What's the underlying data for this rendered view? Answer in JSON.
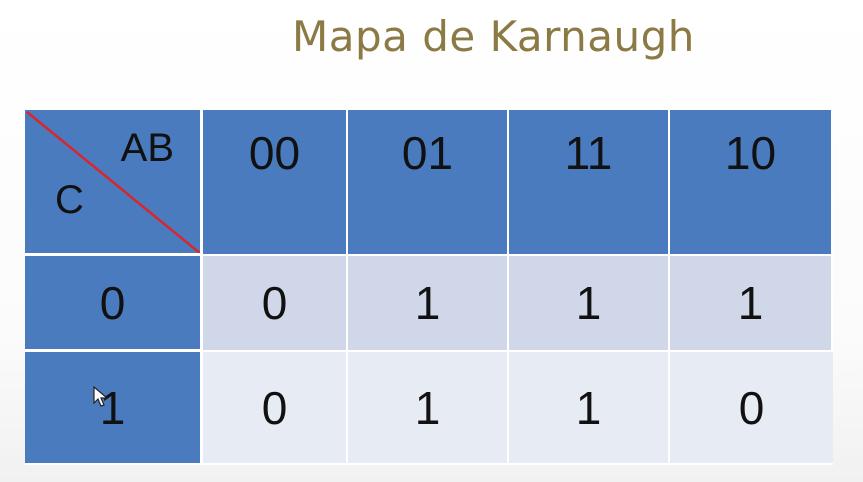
{
  "slide": {
    "title": "Mapa de Karnaugh"
  },
  "kmap": {
    "corner_top_label": "AB",
    "corner_bottom_label": "C",
    "column_headers": [
      "00",
      "01",
      "11",
      "10"
    ],
    "rows": [
      {
        "label": "0",
        "values": [
          "0",
          "1",
          "1",
          "1"
        ]
      },
      {
        "label": "1",
        "values": [
          "0",
          "1",
          "1",
          "0"
        ]
      }
    ],
    "colors": {
      "header_blue": "#4a7bbf",
      "row1_bg": "#cfd7e8",
      "row2_bg": "#e7ebf4",
      "diagonal_red": "#d9262a",
      "title_color": "#8c7a45"
    }
  },
  "cursor": {
    "icon": "mouse-pointer-icon"
  }
}
